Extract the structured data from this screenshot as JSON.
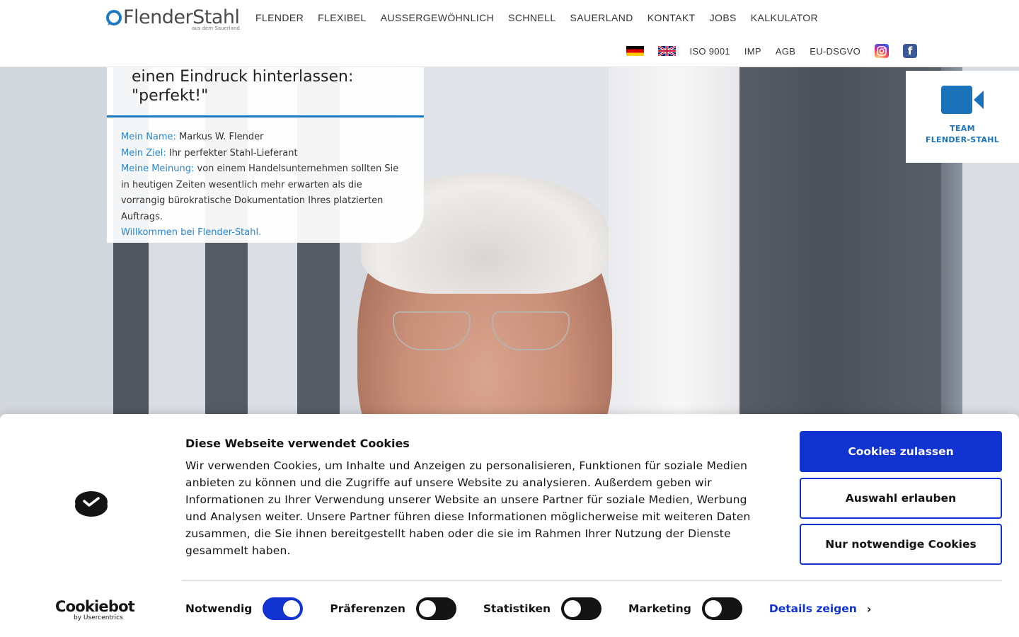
{
  "brand": {
    "name": "FlenderStahl",
    "tagline": "aus dem Sauerland"
  },
  "main_nav": [
    "FLENDER",
    "FLEXIBEL",
    "AUSSERGEWÖHNLICH",
    "SCHNELL",
    "SAUERLAND",
    "KONTAKT",
    "JOBS",
    "KALKULATOR"
  ],
  "sub_nav": {
    "iso": "ISO 9001",
    "imp": "IMP",
    "agb": "AGB",
    "dsgvo": "EU-DSGVO",
    "fb_letter": "f"
  },
  "card": {
    "quote_line1": "einen Eindruck hinterlassen:",
    "quote_line2": "\"perfekt!\"",
    "name_label": "Mein Name:",
    "name_value": "Markus W. Flender",
    "goal_label": "Mein Ziel:",
    "goal_value": "Ihr perfekter Stahl-Lieferant",
    "opinion_label": "Meine Meinung:",
    "opinion_value": "von einem Handelsunternehmen sollten Sie in heutigen Zeiten wesentlich mehr erwarten als die vorrangig bürokratische Dokumentation Ihres platzierten Auftrags.",
    "welcome": "Willkommen bei Flender-Stahl."
  },
  "team": {
    "line1": "TEAM",
    "line2": "FLENDER-STAHL"
  },
  "cookie": {
    "title": "Diese Webseite verwendet Cookies",
    "text": "Wir verwenden Cookies, um Inhalte und Anzeigen zu personalisieren, Funktionen für soziale Medien anbieten zu können und die Zugriffe auf unsere Website zu analysieren. Außerdem geben wir Informationen zu Ihrer Verwendung unserer Website an unsere Partner für soziale Medien, Werbung und Analysen weiter. Unsere Partner führen diese Informationen möglicherweise mit weiteren Daten zusammen, die Sie ihnen bereitgestellt haben oder die sie im Rahmen Ihrer Nutzung der Dienste gesammelt haben.",
    "btn_allow_all": "Cookies zulassen",
    "btn_allow_selection": "Auswahl erlauben",
    "btn_necessary": "Nur notwendige Cookies",
    "toggles": [
      {
        "label": "Notwendig",
        "on": true
      },
      {
        "label": "Präferenzen",
        "on": false
      },
      {
        "label": "Statistiken",
        "on": false
      },
      {
        "label": "Marketing",
        "on": false
      }
    ],
    "details": "Details zeigen",
    "brand": "Cookiebot",
    "brand_sub": "by Usercentrics"
  },
  "colors": {
    "accent": "#1b7ac2",
    "cookie_blue": "#1032cf"
  }
}
